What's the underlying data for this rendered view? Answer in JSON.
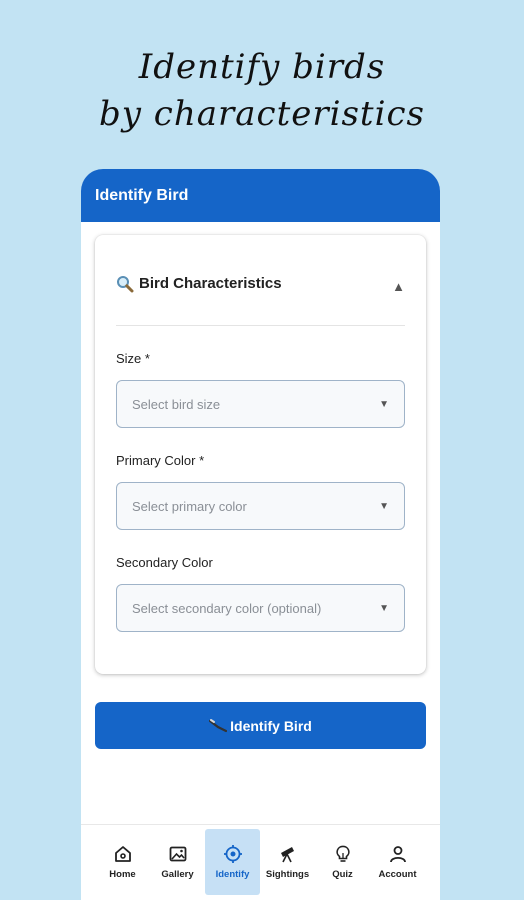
{
  "headline": {
    "line1": "Identify birds",
    "line2": "by characteristics"
  },
  "app_bar": {
    "title": "Identify Bird"
  },
  "card": {
    "title": "Bird Characteristics",
    "collapse_icon": "triangle-up-icon",
    "fields": [
      {
        "label": "Size *",
        "placeholder": "Select bird size"
      },
      {
        "label": "Primary Color *",
        "placeholder": "Select primary color"
      },
      {
        "label": "Secondary Color",
        "placeholder": "Select secondary color (optional)"
      }
    ]
  },
  "action_button": {
    "label": "Identify Bird",
    "icon": "bird-icon"
  },
  "nav": [
    {
      "label": "Home",
      "icon": "home-icon",
      "active": false
    },
    {
      "label": "Gallery",
      "icon": "gallery-icon",
      "active": false
    },
    {
      "label": "Identify",
      "icon": "target-icon",
      "active": true
    },
    {
      "label": "Sightings",
      "icon": "telescope-icon",
      "active": false
    },
    {
      "label": "Quiz",
      "icon": "lightbulb-icon",
      "active": false
    },
    {
      "label": "Account",
      "icon": "person-icon",
      "active": false
    }
  ],
  "colors": {
    "background": "#c2e3f3",
    "primary": "#1565c8",
    "nav_active_bg": "#c6e0f5"
  }
}
